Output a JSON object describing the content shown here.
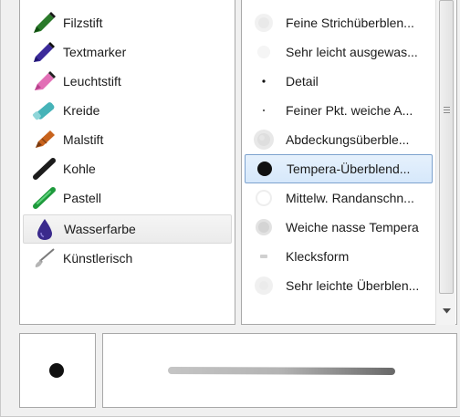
{
  "brush_types": [
    {
      "label": "Filzstift",
      "icon": "felt-pen-icon"
    },
    {
      "label": "Textmarker",
      "icon": "text-marker-icon"
    },
    {
      "label": "Leuchtstift",
      "icon": "highlighter-icon"
    },
    {
      "label": "Kreide",
      "icon": "chalk-icon"
    },
    {
      "label": "Malstift",
      "icon": "crayon-icon"
    },
    {
      "label": "Kohle",
      "icon": "charcoal-icon"
    },
    {
      "label": "Pastell",
      "icon": "pastel-icon"
    },
    {
      "label": "Wasserfarbe",
      "icon": "watercolor-drop-icon",
      "selected": true
    },
    {
      "label": "Künstlerisch",
      "icon": "artistic-brush-icon"
    }
  ],
  "presets": [
    {
      "label": "Feine Strichüberblen...",
      "icon": "faint-blend-icon"
    },
    {
      "label": "Sehr leicht ausgewas...",
      "icon": "very-light-wash-icon"
    },
    {
      "label": "Detail",
      "icon": "small-dot-icon"
    },
    {
      "label": "Feiner Pkt. weiche A...",
      "icon": "tiny-dot-icon"
    },
    {
      "label": "Abdeckungsüberble...",
      "icon": "coverage-blend-icon"
    },
    {
      "label": "Tempera-Überblend...",
      "icon": "large-dot-icon",
      "selected": true
    },
    {
      "label": "Mittelw. Randanschn...",
      "icon": "medium-edge-icon"
    },
    {
      "label": "Weiche nasse Tempera",
      "icon": "soft-wet-icon"
    },
    {
      "label": "Klecksform",
      "icon": "blob-icon"
    },
    {
      "label": "Sehr leichte Überblen...",
      "icon": "very-light-blend-icon"
    }
  ],
  "colors": {
    "selection_fill": "#d6e8fb",
    "selection_border": "#7da2ce",
    "panel_border": "#a8a8a8"
  }
}
